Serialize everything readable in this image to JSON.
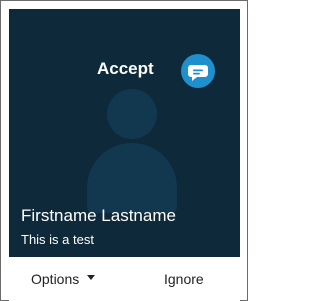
{
  "notification": {
    "accept_label": "Accept",
    "caller_name": "Firstname Lastname",
    "message": "This is a test"
  },
  "actions": {
    "options_label": "Options",
    "ignore_label": "Ignore"
  },
  "icons": {
    "accept": "chat-bubble-icon",
    "options_dropdown": "caret-down-icon",
    "avatar": "person-silhouette-icon"
  },
  "colors": {
    "panel_background": "#0e2a3a",
    "accent": "#1e90ce",
    "avatar_silhouette": "#11384f"
  }
}
